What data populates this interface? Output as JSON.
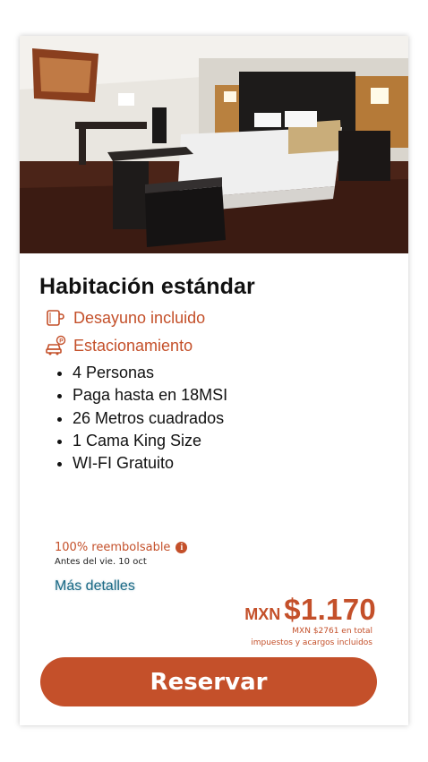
{
  "room": {
    "title": "Habitación estándar",
    "amenities": [
      {
        "label": "Desayuno incluido",
        "icon": "coffee-mug-icon"
      },
      {
        "label": "Estacionamiento",
        "icon": "parking-car-icon"
      }
    ],
    "features": [
      "4 Personas",
      "Paga hasta en 18MSI",
      "26 Metros cuadrados",
      "1 Cama King Size",
      "WI-FI Gratuito"
    ]
  },
  "policy": {
    "refund_label": "100% reembolsable",
    "info_icon": "i",
    "deadline": "Antes del vie. 10 oct"
  },
  "details_link": "Más detalles",
  "price": {
    "currency": "MXN",
    "amount": "$1.170",
    "total_note_line1": "MXN $2761 en total",
    "total_note_line2": "impuestos y acargos incluidos"
  },
  "reserve_button": "Reservar",
  "colors": {
    "accent": "#c4502a",
    "link": "#1c6a86",
    "text": "#111111"
  }
}
